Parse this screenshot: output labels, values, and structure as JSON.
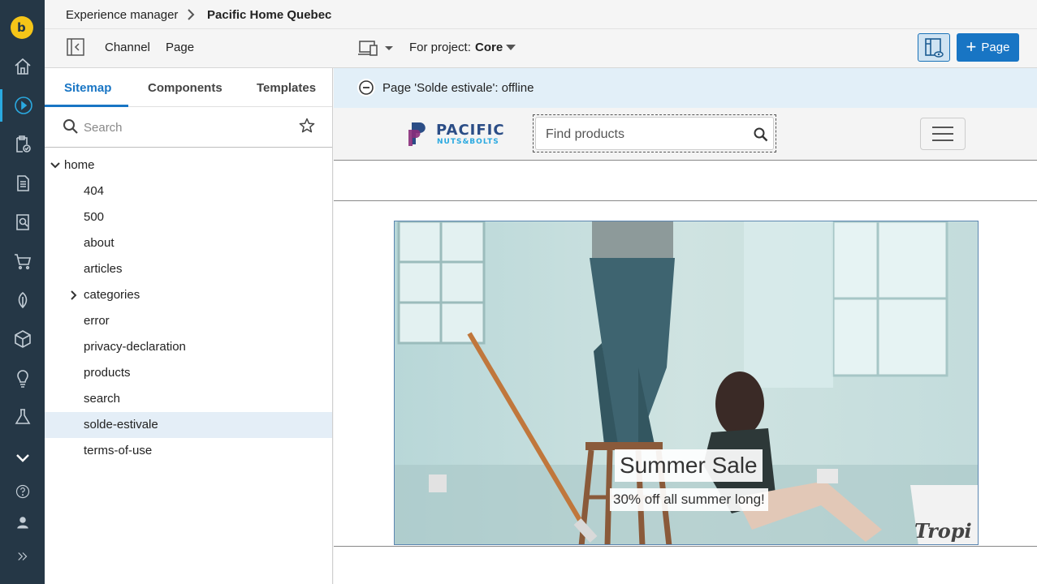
{
  "breadcrumb": {
    "parent": "Experience manager",
    "current": "Pacific Home Quebec"
  },
  "toolbar": {
    "channel_label": "Channel",
    "page_label": "Page",
    "project_label": "For project:",
    "project_value": "Core",
    "add_label": "Page"
  },
  "sidebar": {
    "tabs": [
      "Sitemap",
      "Components",
      "Templates"
    ],
    "search_placeholder": "Search",
    "tree": {
      "root": "home",
      "items": [
        "404",
        "500",
        "about",
        "articles",
        "categories",
        "error",
        "privacy-declaration",
        "products",
        "search",
        "solde-estivale",
        "terms-of-use"
      ],
      "selected": "solde-estivale"
    }
  },
  "preview": {
    "status_text": "Page 'Solde estivale': offline",
    "search_placeholder": "Find products",
    "hero_title": "Summer Sale",
    "hero_subtitle": "30% off all summer long!"
  },
  "colors": {
    "rail": "#253746",
    "accent": "#1875c4",
    "status_bg": "#e2eff8",
    "selected_row": "#e4eef7"
  },
  "icons": [
    "logo-icon",
    "home-icon",
    "experience-manager-icon",
    "projects-icon",
    "documents-icon",
    "content-search-icon",
    "cart-icon",
    "leaf-icon",
    "box-icon",
    "lightbulb-icon",
    "flask-icon",
    "chevron-down-icon",
    "help-icon",
    "user-icon",
    "expand-icon"
  ]
}
